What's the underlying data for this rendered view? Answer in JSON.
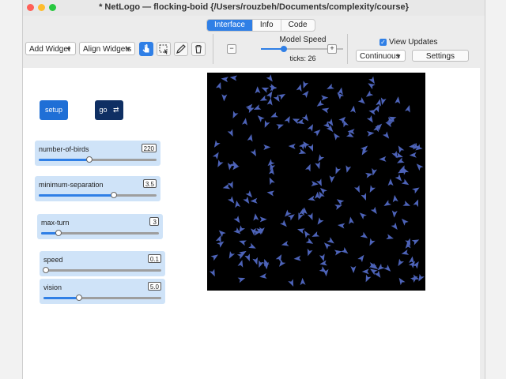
{
  "window": {
    "title": "* NetLogo — flocking-boid {/Users/rouzbeh/Documents/complexity/course}"
  },
  "tabs": [
    {
      "label": "Interface",
      "active": true
    },
    {
      "label": "Info",
      "active": false
    },
    {
      "label": "Code",
      "active": false
    }
  ],
  "toolbar": {
    "add_widget": "Add Widget",
    "align_widgets": "Align Widgets",
    "tools": [
      "pointer-icon",
      "select-icon",
      "pencil-icon",
      "trash-icon"
    ]
  },
  "model_speed": {
    "label": "Model Speed",
    "minus": "−",
    "plus": "+",
    "value": 0.28,
    "ticks_label": "ticks: 26"
  },
  "view_updates": {
    "label": "View Updates",
    "checked": true,
    "mode": "Continuous",
    "settings_label": "Settings"
  },
  "buttons": {
    "setup": {
      "label": "setup",
      "color": "#1f6fd6"
    },
    "go": {
      "label": "go",
      "forever_icon": "⇄",
      "color": "#0f2f63"
    }
  },
  "sliders": [
    {
      "name": "number-of-birds",
      "value": "220",
      "fraction": 0.43
    },
    {
      "name": "minimum-separation",
      "value": "3.5",
      "fraction": 0.64
    },
    {
      "name": "max-turn",
      "value": "3",
      "fraction": 0.15
    },
    {
      "name": "speed",
      "value": "0.1",
      "fraction": 0.02
    },
    {
      "name": "vision",
      "value": "5.0",
      "fraction": 0.3
    }
  ],
  "world": {
    "background": "#000000",
    "turtle_color": "#4d63b8",
    "turtle_count": 220
  },
  "colors": {
    "accent": "#2f7fe6",
    "slider_bg": "#cfe3f8"
  }
}
